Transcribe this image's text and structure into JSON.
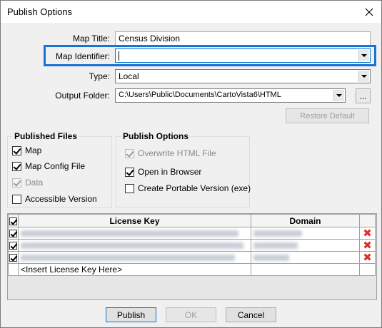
{
  "window": {
    "title": "Publish Options"
  },
  "form": {
    "map_title_label": "Map Title:",
    "map_title_value": "Census Division",
    "map_identifier_label": "Map Identifier:",
    "map_identifier_value": "",
    "type_label": "Type:",
    "type_value": "Local",
    "output_folder_label": "Output Folder:",
    "output_folder_value": "C:\\Users\\Public\\Documents\\CartoVista6\\HTML",
    "browse_label": "...",
    "restore_default_label": "Restore Default",
    "highlight_color": "#1a73d4"
  },
  "published_files": {
    "title": "Published Files",
    "items": [
      {
        "label": "Map",
        "checked": true,
        "enabled": true
      },
      {
        "label": "Map Config File",
        "checked": true,
        "enabled": true
      },
      {
        "label": "Data",
        "checked": true,
        "enabled": false
      },
      {
        "label": "Accessible Version",
        "checked": false,
        "enabled": true
      }
    ]
  },
  "publish_options": {
    "title": "Publish Options",
    "items": [
      {
        "label": "Overwrite HTML File",
        "checked": true,
        "enabled": false
      },
      {
        "label": "Open in Browser",
        "checked": true,
        "enabled": true
      },
      {
        "label": "Create Portable Version (exe)",
        "checked": false,
        "enabled": true
      }
    ]
  },
  "license_grid": {
    "columns": [
      "License Key",
      "Domain"
    ],
    "header_checked": true,
    "rows": [
      {
        "checked": true,
        "key_hidden": true,
        "domain_hidden": true,
        "delete_icon": "delete-x-icon"
      },
      {
        "checked": true,
        "key_hidden": true,
        "domain_hidden": true,
        "delete_icon": "delete-x-icon"
      },
      {
        "checked": true,
        "key_hidden": true,
        "domain_hidden": true,
        "delete_icon": "delete-x-icon"
      }
    ],
    "insert_placeholder": "<Insert License Key Here>"
  },
  "footer": {
    "publish_label": "Publish",
    "ok_label": "OK",
    "cancel_label": "Cancel"
  }
}
